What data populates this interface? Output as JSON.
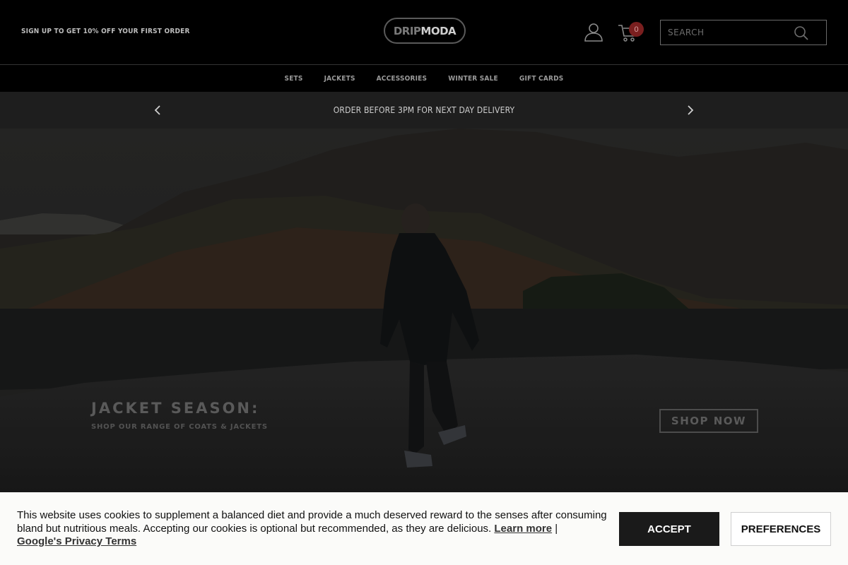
{
  "header": {
    "promo_text": "SIGN UP TO GET 10% OFF YOUR FIRST ORDER",
    "logo": {
      "part1": "DRIP",
      "part2": "MODA"
    },
    "account_icon": "user-icon",
    "cart_icon": "cart-icon",
    "cart_count": "0",
    "search": {
      "placeholder": "SEARCH",
      "value": "",
      "icon": "search-icon"
    }
  },
  "nav": {
    "items": [
      {
        "label": "SETS"
      },
      {
        "label": "JACKETS"
      },
      {
        "label": "ACCESSORIES"
      },
      {
        "label": "WINTER SALE"
      },
      {
        "label": "GIFT CARDS"
      }
    ]
  },
  "announcement": {
    "text": "ORDER BEFORE 3PM FOR NEXT DAY DELIVERY",
    "prev_icon": "chevron-left-icon",
    "next_icon": "chevron-right-icon"
  },
  "hero": {
    "title": "JACKET SEASON:",
    "subtitle": "SHOP OUR RANGE OF COATS & JACKETS",
    "cta_label": "SHOP NOW"
  },
  "cookie_banner": {
    "text": "This website uses cookies to supplement a balanced diet and provide a much deserved reward to the senses after consuming bland but nutritious meals. Accepting our cookies is optional but recommended, as they are delicious.",
    "learn_more_label": "Learn more",
    "separator": "|",
    "privacy_label": "Google's Privacy Terms",
    "accept_label": "ACCEPT",
    "preferences_label": "PREFERENCES"
  },
  "colors": {
    "header_bg": "#000000",
    "announcement_bg": "#1e1e1e",
    "cart_badge": "#7a1f1f",
    "cookie_bg": "#fbfbf9",
    "accept_bg": "#1a1a1a"
  }
}
